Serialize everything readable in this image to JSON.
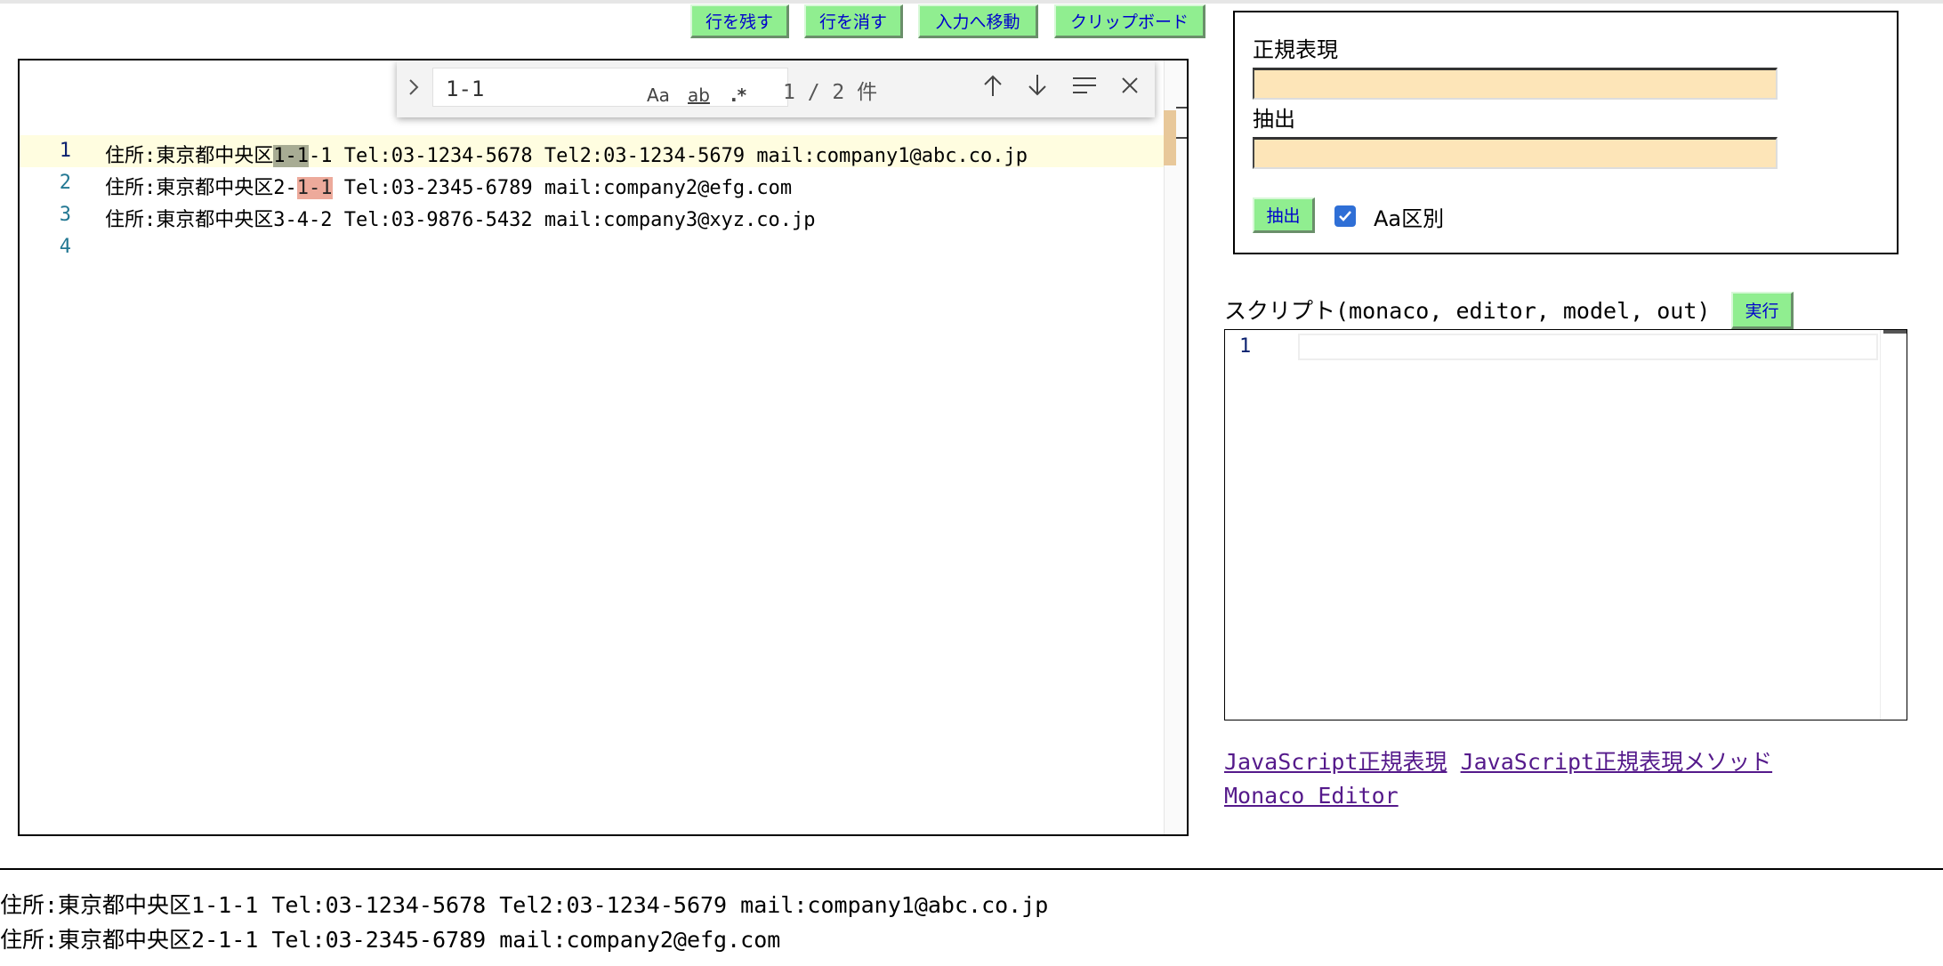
{
  "toolbar": {
    "keep_lines": "行を残す",
    "delete_lines": "行を消す",
    "move_to_input": "入力へ移動",
    "clipboard": "クリップボード"
  },
  "editor": {
    "line_numbers": [
      "1",
      "2",
      "3",
      "4"
    ],
    "lines": [
      {
        "pre": "住所:東京都中央区",
        "match": "1-1",
        "post": "-1 Tel:03-1234-5678 Tel2:03-1234-5679 mail:company1@abc.co.jp"
      },
      {
        "pre": "住所:東京都中央区2-",
        "match": "1-1",
        "post": " Tel:03-2345-6789 mail:company2@efg.com"
      },
      {
        "pre": "住所:東京都中央区3-4-2 Tel:03-9876-5432 mail:company3@xyz.co.jp",
        "match": "",
        "post": ""
      },
      {
        "pre": "",
        "match": "",
        "post": ""
      }
    ]
  },
  "find": {
    "value": "1-1",
    "match_case": "Aa",
    "whole_word": "ab",
    "regex": ".*",
    "count": "1 / 2 件"
  },
  "regex_panel": {
    "regex_label": "正規表現",
    "extract_label": "抽出",
    "extract_button": "抽出",
    "case_label": "Aa区別",
    "case_checked": true
  },
  "script": {
    "label": "スクリプト(monaco, editor, model, out)",
    "run_button": "実行",
    "line_number": "1"
  },
  "links": {
    "regex": "JavaScript正規表現",
    "regex_methods": "JavaScript正規表現メソッド",
    "monaco": "Monaco Editor"
  },
  "output": [
    "住所:東京都中央区1-1-1 Tel:03-1234-5678 Tel2:03-1234-5679 mail:company1@abc.co.jp",
    "住所:東京都中央区2-1-1 Tel:03-2345-6789 mail:company2@efg.com"
  ]
}
